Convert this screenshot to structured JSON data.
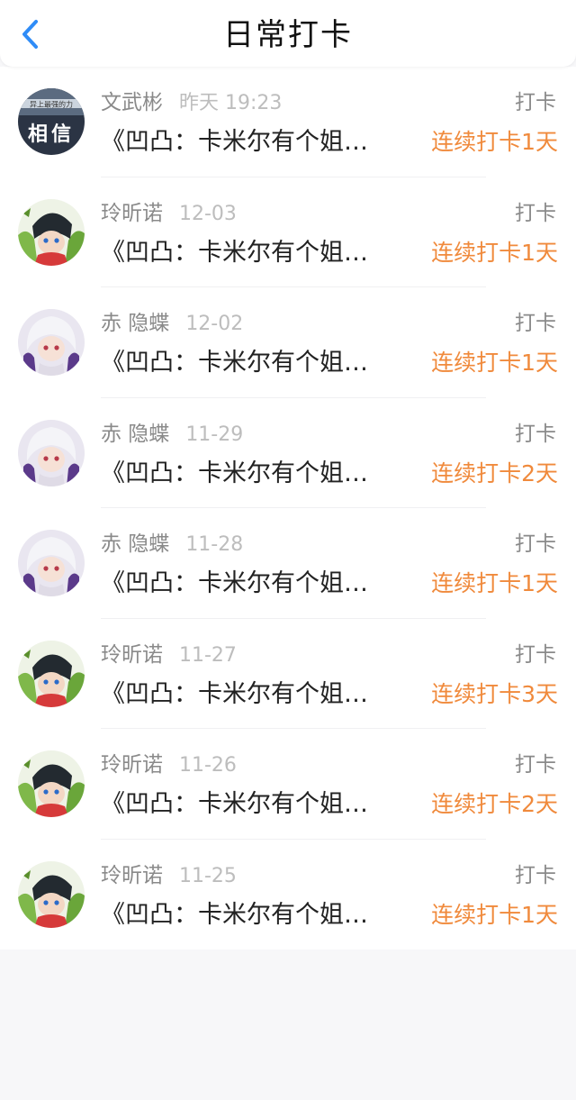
{
  "header": {
    "title": "日常打卡",
    "back_icon": "chevron-left-icon",
    "accent_color": "#2f8cf7"
  },
  "colors": {
    "streak": "#f08a3c",
    "meta": "#8a8a8a",
    "time": "#bdbdbd"
  },
  "records": [
    {
      "user": "文武彬",
      "time": "昨天 19:23",
      "action": "打卡",
      "book": "《凹凸：卡米尔有个姐…",
      "streak": "连续打卡1天",
      "avatar": "text-cover-avatar",
      "avatar_text_top": "异上最强的力",
      "avatar_text_main": "相信"
    },
    {
      "user": "玲昕诺",
      "time": "12-03",
      "action": "打卡",
      "book": "《凹凸：卡米尔有个姐…",
      "streak": "连续打卡1天",
      "avatar": "anime-dark-hair-avatar"
    },
    {
      "user": "赤 隐蝶",
      "time": "12-02",
      "action": "打卡",
      "book": "《凹凸：卡米尔有个姐…",
      "streak": "连续打卡1天",
      "avatar": "anime-white-hair-avatar"
    },
    {
      "user": "赤 隐蝶",
      "time": "11-29",
      "action": "打卡",
      "book": "《凹凸：卡米尔有个姐…",
      "streak": "连续打卡2天",
      "avatar": "anime-white-hair-avatar"
    },
    {
      "user": "赤 隐蝶",
      "time": "11-28",
      "action": "打卡",
      "book": "《凹凸：卡米尔有个姐…",
      "streak": "连续打卡1天",
      "avatar": "anime-white-hair-avatar"
    },
    {
      "user": "玲昕诺",
      "time": "11-27",
      "action": "打卡",
      "book": "《凹凸：卡米尔有个姐…",
      "streak": "连续打卡3天",
      "avatar": "anime-dark-hair-avatar"
    },
    {
      "user": "玲昕诺",
      "time": "11-26",
      "action": "打卡",
      "book": "《凹凸：卡米尔有个姐…",
      "streak": "连续打卡2天",
      "avatar": "anime-dark-hair-avatar"
    },
    {
      "user": "玲昕诺",
      "time": "11-25",
      "action": "打卡",
      "book": "《凹凸：卡米尔有个姐…",
      "streak": "连续打卡1天",
      "avatar": "anime-dark-hair-avatar"
    }
  ]
}
